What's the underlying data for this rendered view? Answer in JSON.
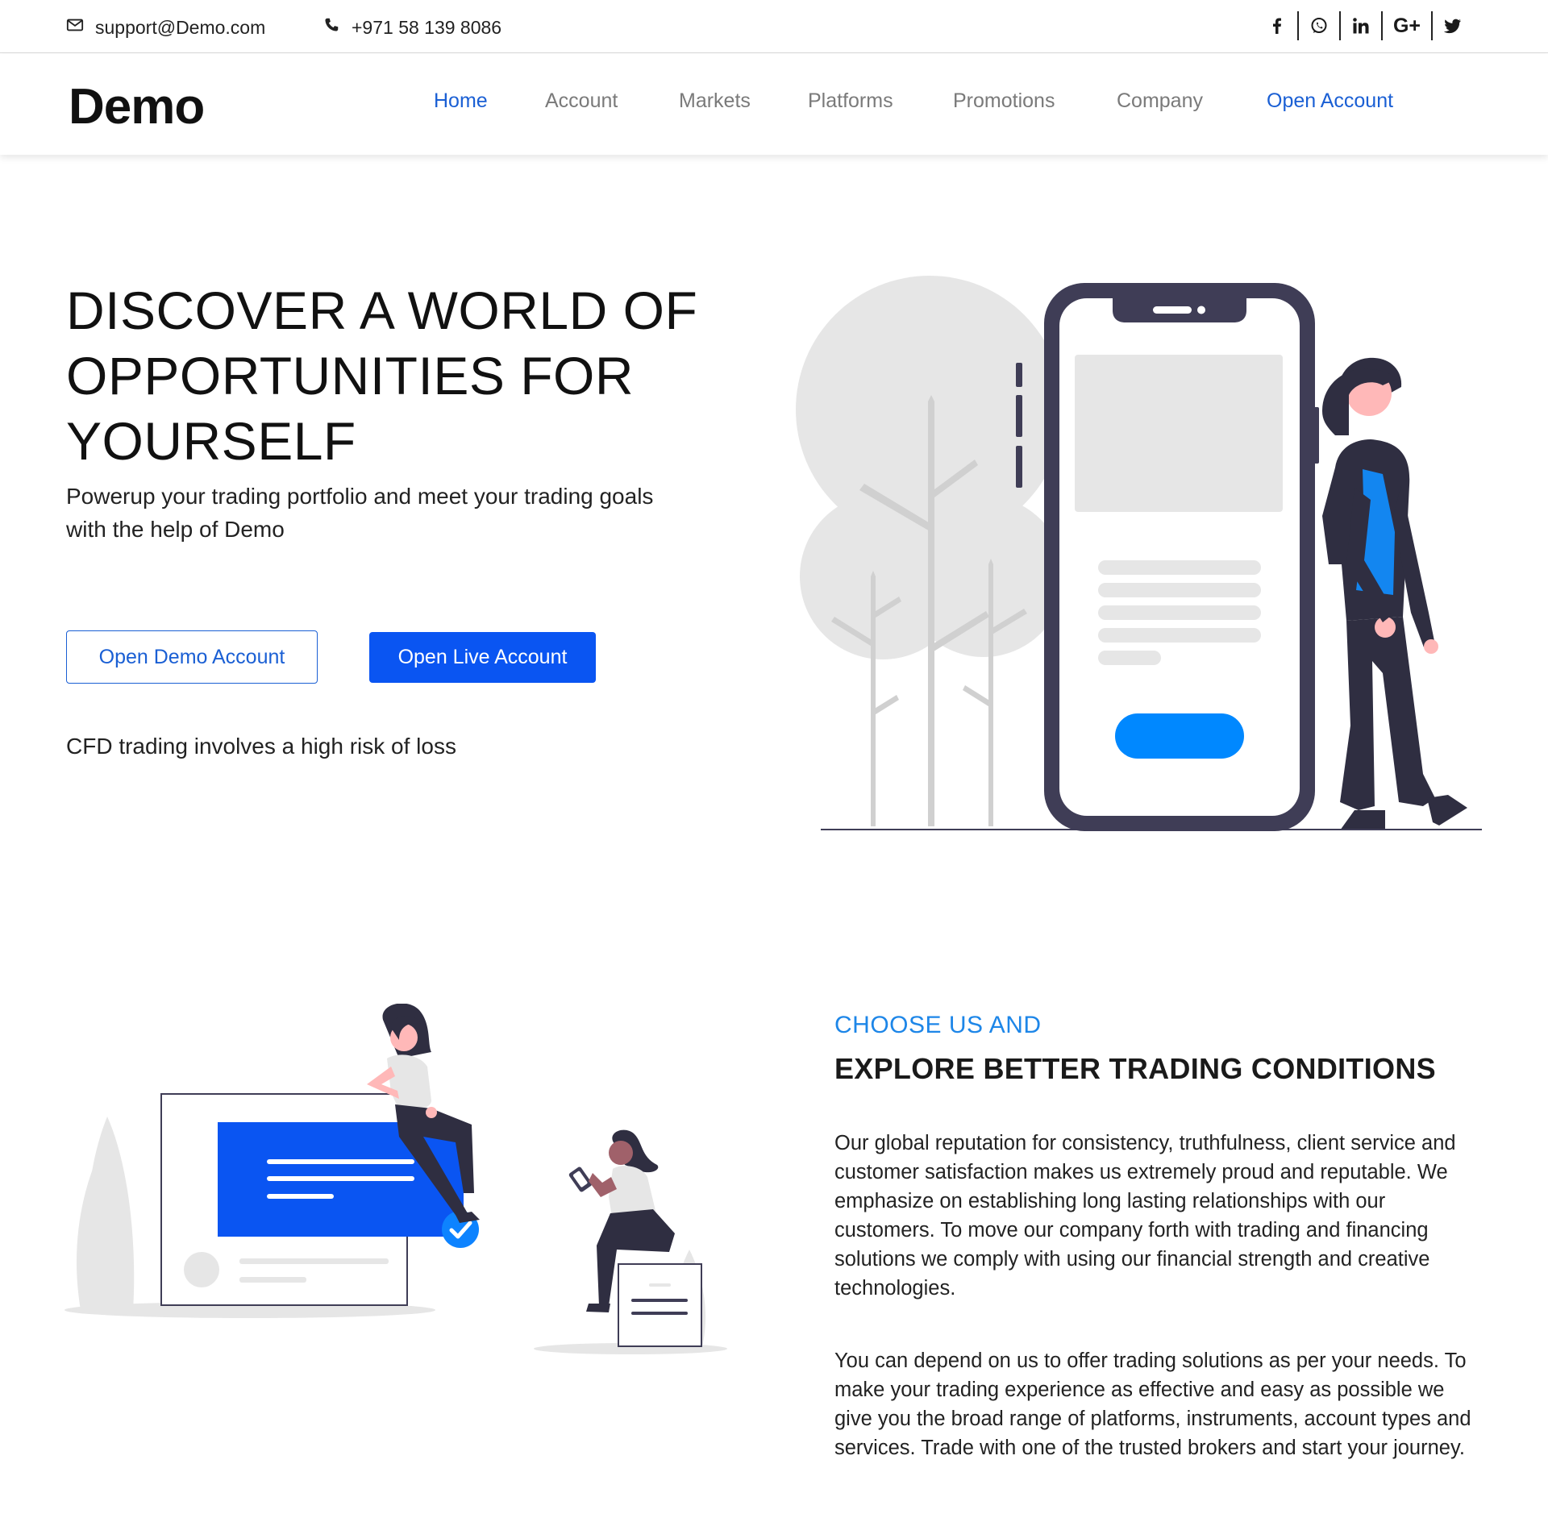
{
  "topbar": {
    "email": "support@Demo.com",
    "phone": "+971 58 139 8086",
    "email_icon": "envelope-icon",
    "phone_icon": "phone-icon",
    "socials": [
      {
        "name": "facebook-icon",
        "glyph": "f"
      },
      {
        "name": "whatsapp-icon",
        "glyph": ""
      },
      {
        "name": "linkedin-icon",
        "glyph": "in"
      },
      {
        "name": "google-plus-icon",
        "glyph": "G+"
      },
      {
        "name": "twitter-icon",
        "glyph": ""
      }
    ]
  },
  "header": {
    "logo": "Demo",
    "nav": [
      "Home",
      "Account",
      "Markets",
      "Platforms",
      "Promotions",
      "Company",
      "Open Account"
    ],
    "active": "Home"
  },
  "hero": {
    "title": "DISCOVER A WORLD OF OPPORTUNITIES FOR YOURSELF",
    "subtitle": "Powerup your trading portfolio and meet your trading goals with the help of Demo",
    "demo_button": "Open Demo Account",
    "live_button": "Open Live Account",
    "risk": "CFD trading involves a high risk of loss"
  },
  "features": {
    "kicker": "CHOOSE US AND",
    "title": "EXPLORE BETTER TRADING CONDITIONS",
    "paragraph1": "Our global reputation for consistency, truthfulness, client service and customer satisfaction makes us extremely proud and reputable. We emphasize on establishing long lasting relationships with our customers. To move our company forth with trading and financing solutions we comply with using our financial strength and creative technologies.",
    "paragraph2": "You can depend on us to offer trading solutions as per your needs. To make your trading experience as effective and easy as possible we give you the broad range of platforms, instruments, account types and services. Trade with one of the trusted brokers and start your journey."
  },
  "colors": {
    "accent": "#0a55f2",
    "link": "#1a5fd4",
    "kicker": "#1d86e8",
    "illustration_dark": "#3f3d56",
    "illustration_gray": "#e6e6e6",
    "skin": "#ffb8b8"
  }
}
